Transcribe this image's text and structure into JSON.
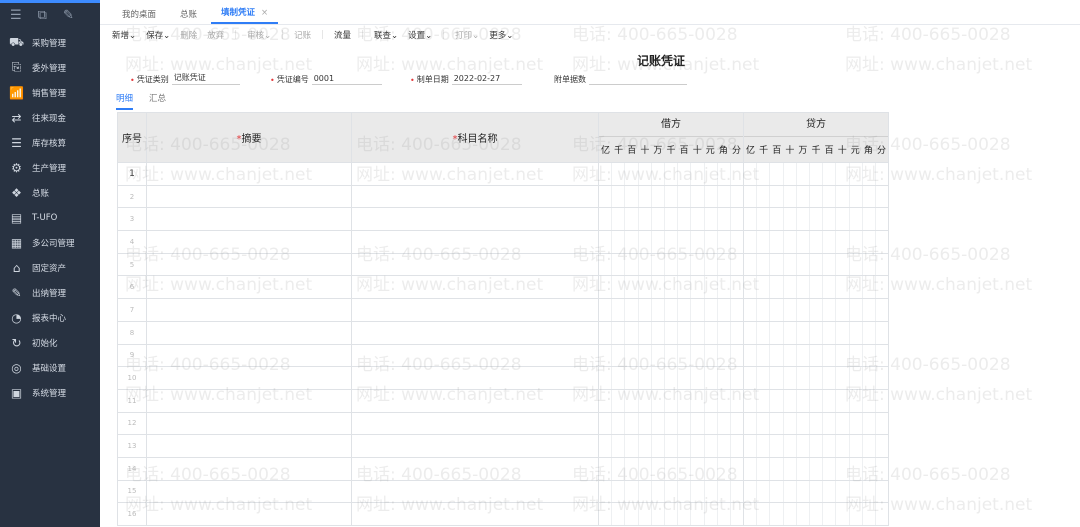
{
  "sidebar": {
    "top_icons": [
      "menu-icon",
      "workspace-icon",
      "edit-icon"
    ],
    "items": [
      {
        "label": "采购管理",
        "icon": "cart-icon",
        "glyph": "⛟"
      },
      {
        "label": "委外管理",
        "icon": "outsource-icon",
        "glyph": "⎘"
      },
      {
        "label": "销售管理",
        "icon": "sales-chart-icon",
        "glyph": "📶"
      },
      {
        "label": "往来现金",
        "icon": "exchange-icon",
        "glyph": "⇄"
      },
      {
        "label": "库存核算",
        "icon": "inventory-icon",
        "glyph": "☰"
      },
      {
        "label": "生产管理",
        "icon": "production-icon",
        "glyph": "⚙"
      },
      {
        "label": "总账",
        "icon": "ledger-icon",
        "glyph": "❖"
      },
      {
        "label": "T-UFO",
        "icon": "ufo-icon",
        "glyph": "▤"
      },
      {
        "label": "多公司管理",
        "icon": "multi-company-icon",
        "glyph": "▦"
      },
      {
        "label": "固定资产",
        "icon": "asset-icon",
        "glyph": "⌂"
      },
      {
        "label": "出纳管理",
        "icon": "cashier-icon",
        "glyph": "✎"
      },
      {
        "label": "报表中心",
        "icon": "report-icon",
        "glyph": "◔"
      },
      {
        "label": "初始化",
        "icon": "init-icon",
        "glyph": "↻"
      },
      {
        "label": "基础设置",
        "icon": "base-settings-icon",
        "glyph": "◎"
      },
      {
        "label": "系统管理",
        "icon": "system-icon",
        "glyph": "▣"
      }
    ]
  },
  "tabs": [
    {
      "label": "我的桌面"
    },
    {
      "label": "总账"
    },
    {
      "label": "填制凭证",
      "close": "×"
    }
  ],
  "toolbar": [
    {
      "label": "新增⌄",
      "enabled": true
    },
    {
      "label": "保存⌄",
      "enabled": true
    },
    {
      "label": "删除",
      "enabled": false
    },
    {
      "label": "放弃",
      "enabled": false
    },
    {
      "label": "审核⌄",
      "enabled": false
    },
    {
      "label": "记账",
      "enabled": false
    },
    {
      "label": "流量",
      "enabled": true
    },
    {
      "label": "联查⌄",
      "enabled": true
    },
    {
      "label": "设置⌄",
      "enabled": true
    },
    {
      "label": "打印⌄",
      "enabled": false
    },
    {
      "label": "更多⌄",
      "enabled": true
    }
  ],
  "voucher": {
    "title": "记账凭证",
    "type_label": "凭证类别",
    "type_value": "记账凭证",
    "number_label": "凭证编号",
    "number_value": "0001",
    "date_label": "制单日期",
    "date_value": "2022-02-27",
    "attach_label": "附单据数",
    "attach_value": ""
  },
  "subtabs": [
    {
      "label": "明细"
    },
    {
      "label": "汇总"
    }
  ],
  "table": {
    "col_seq": "序号",
    "col_summary": "摘要",
    "col_account": "科目名称",
    "col_debit": "借方",
    "col_credit": "贷方",
    "digit_units": [
      "亿",
      "千",
      "百",
      "十",
      "万",
      "千",
      "百",
      "十",
      "元",
      "角",
      "分"
    ],
    "rows": [
      "1",
      "2",
      "3",
      "4",
      "5",
      "6",
      "7",
      "8",
      "9",
      "10",
      "11",
      "12",
      "13",
      "14",
      "15",
      "16"
    ]
  },
  "watermark": {
    "phone": "电话: 400-665-0028",
    "site": "网址: www.chanjet.net"
  }
}
